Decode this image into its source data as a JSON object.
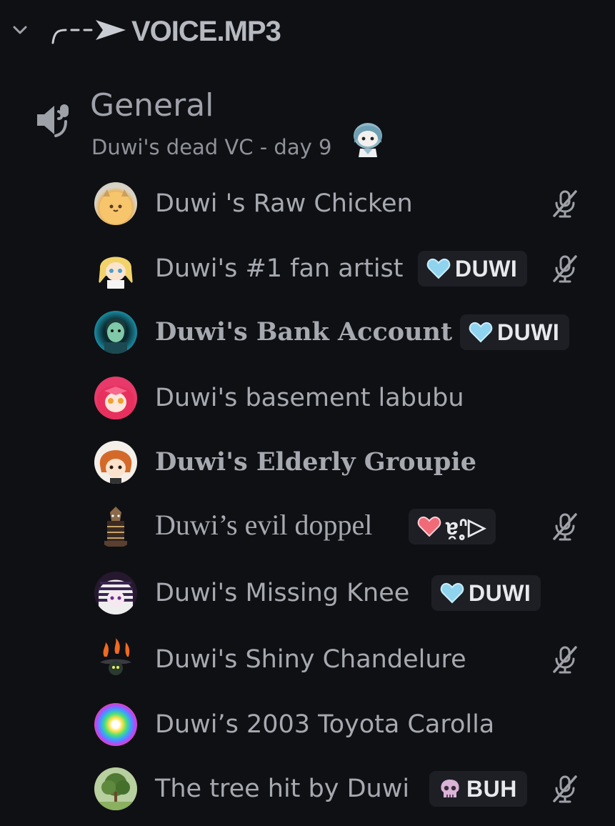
{
  "category": {
    "title": "VOICE.MP3",
    "collapse_icon": "chevron-down-icon",
    "decoration_icon": "dashed-arrow-icon"
  },
  "channel": {
    "name": "General",
    "status": "Duwi's dead VC - day 9",
    "icon": "voice-channel-speaker-icon",
    "status_emoji": "chibi-character-emoji"
  },
  "users": [
    {
      "name": "Duwi 's Raw Chicken",
      "muted": true,
      "tag": null,
      "avatar": "cat-pancake-avatar"
    },
    {
      "name": "Duwi's #1 fan artist",
      "muted": true,
      "tag": {
        "label": "DUWI",
        "icon": "blue-heart-icon",
        "color": "#8fd3ef"
      },
      "avatar": "blonde-anime-avatar"
    },
    {
      "name": "Duwi's Bank Account",
      "muted": false,
      "tag": {
        "label": "DUWI",
        "icon": "blue-heart-icon",
        "color": "#8fd3ef"
      },
      "avatar": "green-character-avatar"
    },
    {
      "name": "Duwi's basement labubu",
      "muted": false,
      "tag": null,
      "avatar": "pink-hair-avatar"
    },
    {
      "name": "Duwi's Elderly Groupie",
      "muted": false,
      "tag": null,
      "avatar": "orange-hair-avatar"
    },
    {
      "name": "Duwi’s evil doppel",
      "muted": true,
      "tag": {
        "label": "ɐ̯ᐢ̥▷",
        "icon": "red-heart-icon",
        "color": "#f06a78"
      },
      "avatar": "dark-figure-avatar"
    },
    {
      "name": "Duwi's Missing Knee",
      "muted": false,
      "tag": {
        "label": "DUWI",
        "icon": "blue-heart-icon",
        "color": "#8fd3ef"
      },
      "avatar": "striped-hair-avatar"
    },
    {
      "name": "Duwi's Shiny Chandelure",
      "muted": true,
      "tag": null,
      "avatar": "chandelure-avatar"
    },
    {
      "name": "Duwi’s 2003 Toyota Carolla",
      "muted": false,
      "tag": null,
      "avatar": "rainbow-cube-avatar"
    },
    {
      "name": "The tree hit by Duwi",
      "muted": true,
      "tag": {
        "label": "BUH",
        "icon": "skull-icon",
        "color": "#d9b3d6"
      },
      "avatar": "tree-avatar"
    }
  ],
  "colors": {
    "background": "#0f1014",
    "tag_background": "#1d1f25",
    "text_muted": "#a6a9b0"
  }
}
